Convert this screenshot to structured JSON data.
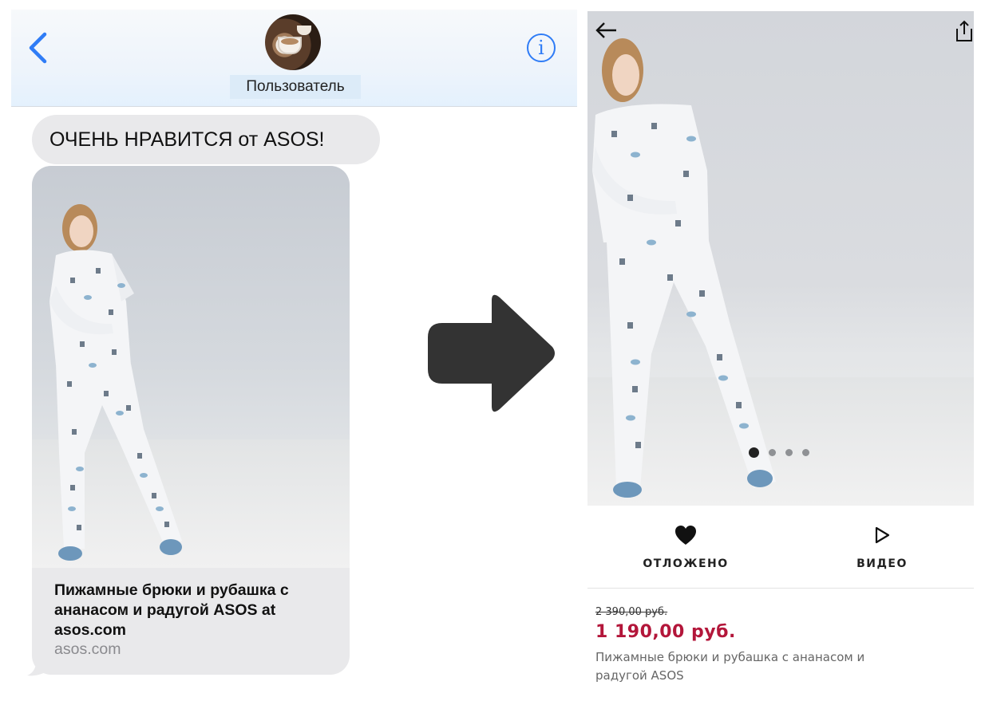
{
  "message_thread": {
    "contact_name": "Пользователь",
    "info_glyph": "i",
    "message_text": "ОЧЕНЬ НРАВИТСЯ от ASOS!",
    "link_preview": {
      "title": "Пижамные брюки и рубашка с ананасом и радугой ASOS at asos.com",
      "domain": "asos.com"
    }
  },
  "product_page": {
    "actions": {
      "saved_label": "ОТЛОЖЕНО",
      "video_label": "ВИДЕО"
    },
    "old_price": "2 390,00 руб.",
    "price": "1 190,00 руб.",
    "product_name": "Пижамные брюки и рубашка с ананасом и радугой ASOS",
    "gallery": {
      "total_images": 4,
      "active_index": 0
    }
  },
  "colors": {
    "ios_blue": "#2f7cf6",
    "bubble_gray": "#e9e9eb",
    "sale_price_red": "#b3163a",
    "arrow_dark": "#333333"
  },
  "icons": [
    "chevron-left-icon",
    "info-icon",
    "arrow-left-icon",
    "share-icon",
    "heart-icon",
    "play-icon",
    "right-arrow-icon"
  ]
}
